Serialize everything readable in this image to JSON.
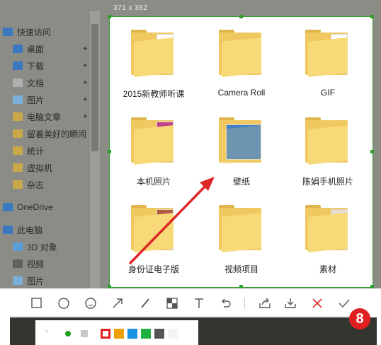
{
  "capture": {
    "size_label": "371 x 382"
  },
  "sidebar": {
    "items": [
      {
        "label": "快速访问",
        "icon": "star-icon",
        "pinned": false
      },
      {
        "label": "桌面",
        "icon": "desktop-icon",
        "pinned": true
      },
      {
        "label": "下载",
        "icon": "download-icon",
        "pinned": true
      },
      {
        "label": "文档",
        "icon": "document-icon",
        "pinned": true
      },
      {
        "label": "图片",
        "icon": "pictures-icon",
        "pinned": true
      },
      {
        "label": "电脑文章",
        "icon": "folder-icon",
        "pinned": true
      },
      {
        "label": "留着美好的瞬间",
        "icon": "folder-icon",
        "pinned": false
      },
      {
        "label": "统计",
        "icon": "folder-icon",
        "pinned": false
      },
      {
        "label": "虚拟机",
        "icon": "folder-icon",
        "pinned": false
      },
      {
        "label": "杂志",
        "icon": "folder-icon",
        "pinned": false
      },
      {
        "label": "OneDrive",
        "icon": "cloud-icon",
        "pinned": false
      },
      {
        "label": "此电脑",
        "icon": "computer-icon",
        "pinned": false
      },
      {
        "label": "3D 对象",
        "icon": "cube-icon",
        "pinned": false
      },
      {
        "label": "视频",
        "icon": "video-icon",
        "pinned": false
      },
      {
        "label": "图片",
        "icon": "pictures-icon",
        "pinned": false
      }
    ]
  },
  "folders": [
    {
      "name": "2015新教师听课"
    },
    {
      "name": "Camera Roll"
    },
    {
      "name": "GIF"
    },
    {
      "name": "本机照片"
    },
    {
      "name": "壁纸"
    },
    {
      "name": "陈娟手机照片"
    },
    {
      "name": "身份证电子版"
    },
    {
      "name": "视频项目"
    },
    {
      "name": "素材"
    }
  ],
  "toolbar": {
    "tools": [
      "rectangle-icon",
      "ellipse-icon",
      "emoji-icon",
      "arrow-icon",
      "pen-icon",
      "mosaic-icon",
      "text-icon",
      "undo-icon",
      "share-icon",
      "save-icon",
      "close-icon",
      "confirm-icon"
    ]
  },
  "palette": {
    "colors": [
      "#e02020",
      "#f0a000",
      "#1a90e0",
      "#20b040",
      "#555555",
      "#f4f4f4"
    ],
    "selected_color": "#e02020",
    "selected_dot_color": "#1aa01a"
  },
  "badge": {
    "text": "8"
  },
  "colors": {
    "selection_border": "#2ca02c",
    "annotation_arrow": "#e02828"
  }
}
